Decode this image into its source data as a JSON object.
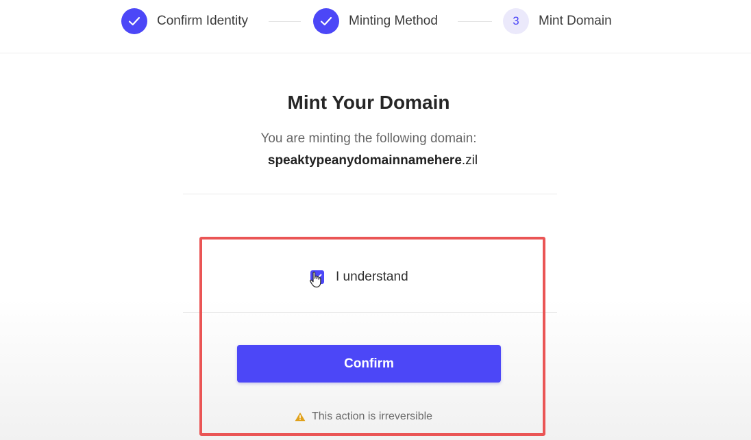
{
  "stepper": {
    "steps": [
      {
        "label": "Confirm Identity",
        "state": "done",
        "icon": "check-icon"
      },
      {
        "label": "Minting Method",
        "state": "done",
        "icon": "check-icon"
      },
      {
        "label": "Mint Domain",
        "state": "current",
        "number": "3"
      }
    ]
  },
  "main": {
    "title": "Mint Your Domain",
    "subtitle": "You are minting the following domain:",
    "domain_name": "speaktypeanydomainnamehere",
    "domain_tld": ".zil",
    "understand_label": "I understand",
    "understand_checked": true,
    "confirm_label": "Confirm",
    "warning_text": "This action is irreversible",
    "warning_icon": "warning-triangle-icon"
  },
  "colors": {
    "accent": "#4c47f7",
    "highlight": "#ea5555",
    "warning": "#e0a11b"
  }
}
